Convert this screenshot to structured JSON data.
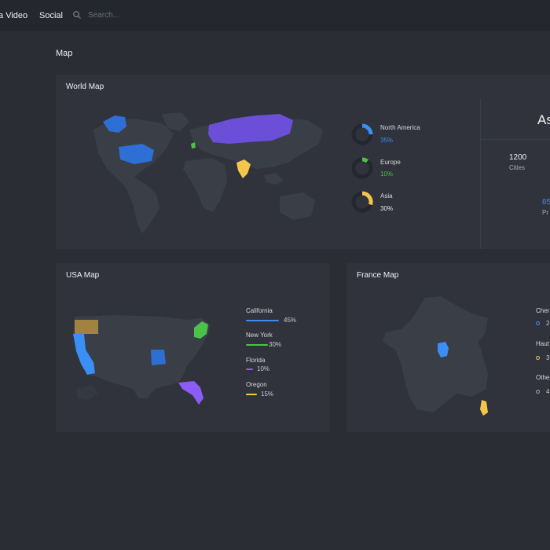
{
  "header": {
    "nav": [
      "Video",
      "Social"
    ],
    "nav_prefix": "a",
    "search_placeholder": "Search..."
  },
  "page": {
    "title": "Map"
  },
  "world_map": {
    "title": "World Map",
    "legend": [
      {
        "name": "North America",
        "value": "35%",
        "percent": 35,
        "color": "#3a8ef6"
      },
      {
        "name": "Europe",
        "value": "10%",
        "percent": 10,
        "color": "#4cc14a"
      },
      {
        "name": "Asia",
        "value": "30%",
        "percent": 30,
        "color": "#f5c64a"
      }
    ],
    "stats": {
      "heading": "As",
      "cities_value": "1200",
      "cities_label": "Cities",
      "partial_value": "65",
      "partial_label": "Pr"
    }
  },
  "usa_map": {
    "title": "USA Map",
    "legend": [
      {
        "name": "California",
        "value": "45%",
        "percent": 45,
        "color": "#3a8ef6"
      },
      {
        "name": "New York",
        "value": "30%",
        "percent": 30,
        "color": "#4cc14a"
      },
      {
        "name": "Florida",
        "value": "10%",
        "percent": 10,
        "color": "#8b5cf6"
      },
      {
        "name": "Oregon",
        "value": "15%",
        "percent": 15,
        "color": "#f5c64a"
      }
    ]
  },
  "france_map": {
    "title": "France Map",
    "legend": [
      {
        "name": "Cher",
        "value": "2",
        "color": "#3a8ef6"
      },
      {
        "name": "Haut",
        "value": "3",
        "color": "#f5c64a"
      },
      {
        "name": "Othe",
        "value": "4",
        "color": "#a0a4ab"
      }
    ]
  }
}
